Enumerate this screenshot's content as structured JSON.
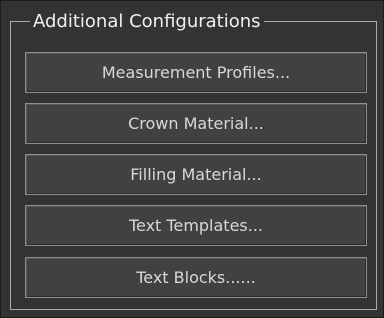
{
  "group": {
    "title": "Additional Configurations"
  },
  "buttons": [
    {
      "label": "Measurement Profiles..."
    },
    {
      "label": "Crown Material..."
    },
    {
      "label": "Filling Material..."
    },
    {
      "label": "Text Templates..."
    },
    {
      "label": "Text Blocks......"
    }
  ],
  "colors": {
    "background": "#333333",
    "border": "#a9a9a9",
    "button_fill": "#414141",
    "button_text": "#d8d8d8"
  }
}
